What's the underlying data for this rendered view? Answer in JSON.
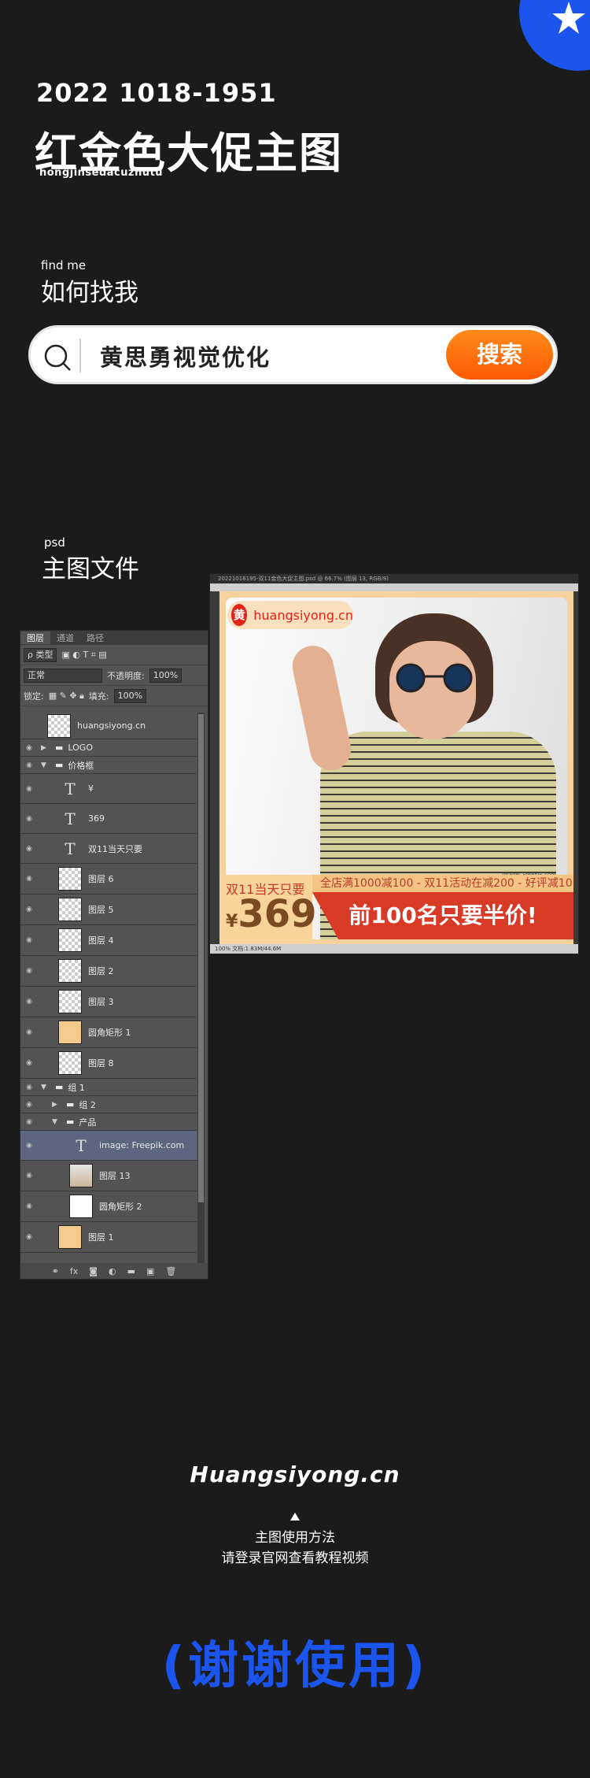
{
  "header": {
    "year": "2022",
    "code": "1018-1951",
    "title": "红金色大促主图",
    "pinyin": "hongjinsedacuzhutu"
  },
  "find": {
    "label_en": "find me",
    "label_zh": "如何找我",
    "search_query": "黄思勇视觉优化",
    "search_button": "搜索"
  },
  "psd": {
    "label_en": "psd",
    "label_zh": "主图文件"
  },
  "layers_panel": {
    "tabs": [
      "图层",
      "通道",
      "路径"
    ],
    "filter_kind": "ρ 类型",
    "blend_mode": "正常",
    "opacity_label": "不透明度:",
    "opacity_value": "100%",
    "lock_label": "锁定:",
    "fill_label": "填充:",
    "fill_value": "100%",
    "layers": [
      {
        "name": "huangsiyong.cn",
        "kind": "smart"
      },
      {
        "name": "LOGO",
        "kind": "group"
      },
      {
        "name": "价格框",
        "kind": "group-open"
      },
      {
        "name": "¥",
        "kind": "text"
      },
      {
        "name": "369",
        "kind": "text"
      },
      {
        "name": "双11当天只要",
        "kind": "text"
      },
      {
        "name": "图层 6",
        "kind": "pixel"
      },
      {
        "name": "图层 5",
        "kind": "pixel"
      },
      {
        "name": "图层 4",
        "kind": "pixel"
      },
      {
        "name": "图层 2",
        "kind": "pixel"
      },
      {
        "name": "图层 3",
        "kind": "pixel"
      },
      {
        "name": "圆角矩形 1",
        "kind": "shape"
      },
      {
        "name": "图层 8",
        "kind": "pixel"
      },
      {
        "name": "组 1",
        "kind": "group-open"
      },
      {
        "name": "组 2",
        "kind": "group"
      },
      {
        "name": "产品",
        "kind": "group-open"
      },
      {
        "name": "image: Freepik.com",
        "kind": "text"
      },
      {
        "name": "图层 13",
        "kind": "photo"
      },
      {
        "name": "圆角矩形 2",
        "kind": "shape-white"
      },
      {
        "name": "图层 1",
        "kind": "fill"
      }
    ]
  },
  "doc": {
    "title": "20221018195-双11金色大促主图.psd @ 66.7% (图层 13, RGB/8)",
    "logo_text": "huangsiyong.cn",
    "logo_mark": "黄",
    "credit": "image: Freepik.com",
    "price_label": "双11当天只要",
    "price_currency": "¥",
    "price_value": "369",
    "promo": "全店满1000减100 - 双11活动在减200 - 好评减10",
    "banner": "前100名只要半价!",
    "status_zoom": "100%",
    "status_doc": "文档:1.83M/44.6M"
  },
  "footer": {
    "site": "Huangsiyong.cn",
    "how_line1": "主图使用方法",
    "how_line2": "请登录官网查看教程视频",
    "thanks": "(谢谢使用)"
  },
  "colors": {
    "accent_blue": "#1b55ee",
    "orange": "#ff6a00",
    "background": "#1b1b1b"
  }
}
